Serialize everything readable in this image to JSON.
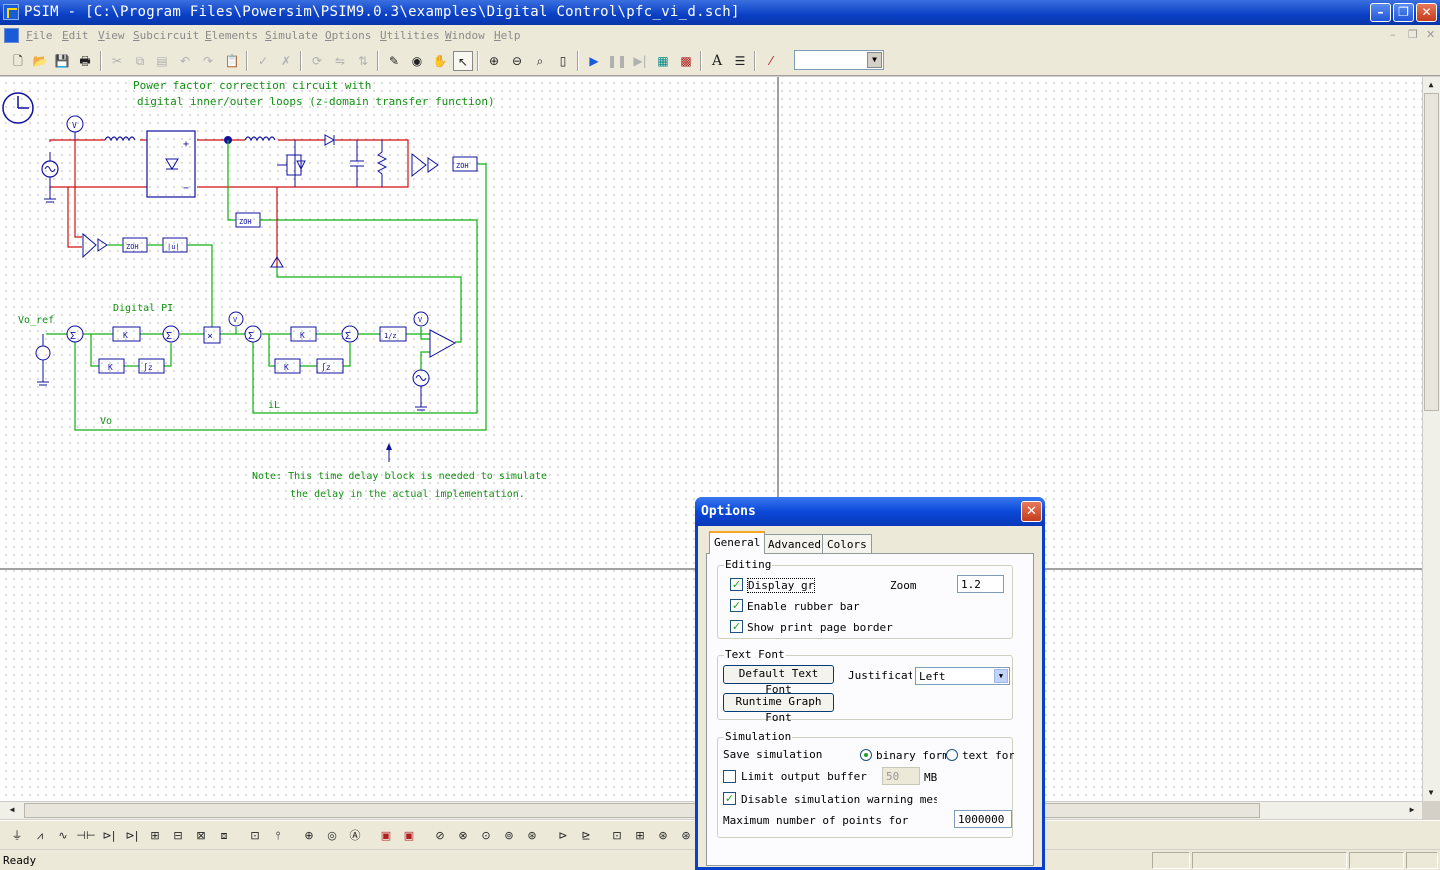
{
  "window": {
    "title": "PSIM - [C:\\Program Files\\Powersim\\PSIM9.0.3\\examples\\Digital Control\\pfc_vi_d.sch]",
    "min_symbol": "–",
    "restore_symbol": "❐",
    "close_symbol": "✕"
  },
  "menu": {
    "items": [
      "File",
      "Edit",
      "View",
      "Subcircuit",
      "Elements",
      "Simulate",
      "Options",
      "Utilities",
      "Window",
      "Help"
    ],
    "mdi_min": "–",
    "mdi_restore": "❐",
    "mdi_close": "✕"
  },
  "toolbar": {
    "icons": [
      "new-icon",
      "open-icon",
      "save-icon",
      "print-icon",
      "cut-icon",
      "copy-icon",
      "paste-icon",
      "undo-icon",
      "redo-icon",
      "paste-clipboard-icon",
      "check-icon",
      "cross-icon",
      "rotate-icon",
      "flip-lr-icon",
      "flip-tb-icon",
      "wire-icon",
      "label-icon",
      "pan-icon",
      "select-icon",
      "zoom-in-icon",
      "zoom-out-icon",
      "zoom-fit-icon",
      "page-icon",
      "run-icon",
      "pause-icon",
      "step-icon",
      "simview-icon",
      "parameter-icon",
      "text-icon",
      "text-list-icon",
      "escape-icon"
    ],
    "combo_value": ""
  },
  "schematic": {
    "title_line1": "Power factor correction circuit with",
    "title_line2": "digital inner/outer loops (z-domain transfer function)",
    "label_digital_pi": "Digital PI",
    "label_vo_ref": "Vo_ref",
    "label_vo": "Vo",
    "label_il": "iL",
    "note_line1": "Note: This time delay block is needed to simulate",
    "note_line2": "the delay in the actual implementation.",
    "zoh": "ZOH",
    "abs": "|u|",
    "volt": "V",
    "gain": "K",
    "integ": "∫z",
    "delay": "1/z",
    "sum": "Σ",
    "mult": "×"
  },
  "status": {
    "text": "Ready"
  },
  "dialog": {
    "title": "Options",
    "close_symbol": "✕",
    "tabs": [
      "General",
      "Advanced",
      "Colors"
    ],
    "editing": {
      "label": "Editing",
      "display_grid": "Display gr",
      "rubber_band": "Enable rubber bar",
      "print_border": "Show print page border",
      "zoom_label": "Zoom",
      "zoom_value": "1.2",
      "check_mark": "✓"
    },
    "text_font": {
      "label": "Text Font",
      "default_button": "Default Text Font",
      "justification_label": "Justificat",
      "justification_value": "Left",
      "graph_button": "Runtime Graph Font"
    },
    "simulation": {
      "label": "Simulation",
      "save_label": "Save simulation",
      "binary": "binary form",
      "text": "text form",
      "limit_buffer": "Limit output buffer",
      "buffer_value": "50",
      "buffer_unit": "MB",
      "disable_warning": "Disable simulation warning messa",
      "max_points_label": "Maximum number of points for",
      "max_points_value": "1000000"
    }
  }
}
